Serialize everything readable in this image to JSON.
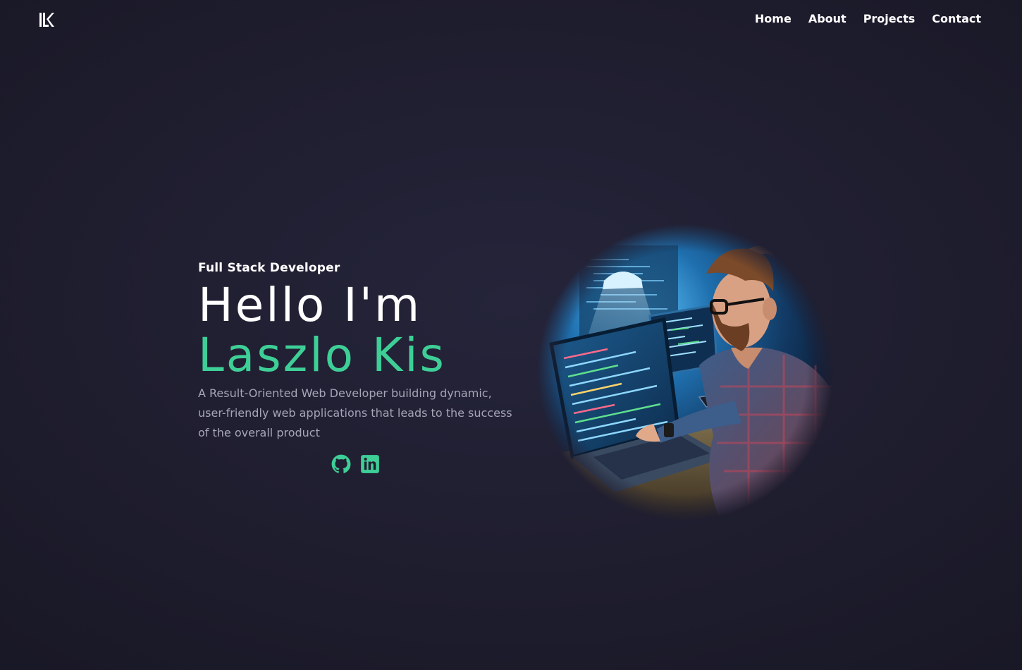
{
  "header": {
    "logo_text": "LK",
    "nav": [
      {
        "label": "Home"
      },
      {
        "label": "About"
      },
      {
        "label": "Projects"
      },
      {
        "label": "Contact"
      }
    ]
  },
  "hero": {
    "subtitle": "Full Stack Developer",
    "headline": "Hello I'm",
    "name": "Laszlo Kis",
    "description": "A Result-Oriented Web Developer building dynamic, user-friendly web applications that leads to the success of the overall product",
    "socials": [
      {
        "icon": "github-icon"
      },
      {
        "icon": "linkedin-icon"
      }
    ]
  },
  "colors": {
    "background": "#1d1c2a",
    "accent": "#3ecf97",
    "text": "#ffffff",
    "muted_text": "#a5a5b6"
  }
}
